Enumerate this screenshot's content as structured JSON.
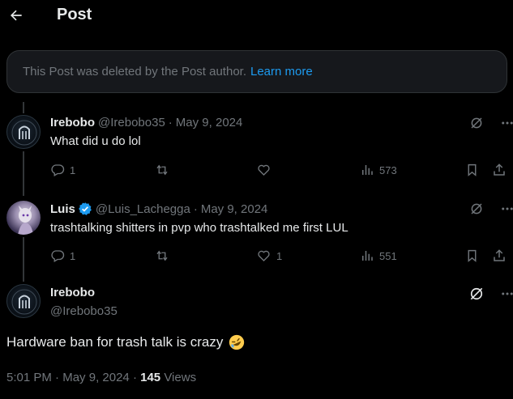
{
  "header": {
    "title": "Post",
    "back_icon": "arrow-left-icon"
  },
  "deleted_notice": {
    "text": "This Post was deleted by the Post author.",
    "link": "Learn more"
  },
  "replies": [
    {
      "name": "Irebobo",
      "handle": "@Irebobo35",
      "date": "May 9, 2024",
      "text": "What did u do lol",
      "replies": "1",
      "reposts": "",
      "likes": "",
      "views": "573"
    },
    {
      "name": "Luis",
      "verified": true,
      "handle": "@Luis_Lachegga",
      "date": "May 9, 2024",
      "text": "trashtalking shitters in pvp who trashtalked me first LUL",
      "replies": "1",
      "reposts": "",
      "likes": "1",
      "views": "551"
    }
  ],
  "main_post": {
    "name": "Irebobo",
    "handle": "@Irebobo35",
    "text": "Hardware ban for trash talk is crazy",
    "emoji": "rolling-on-floor-laughing-emoji",
    "time": "5:01 PM",
    "date": "May 9, 2024",
    "views_count": "145",
    "views_label": "Views"
  },
  "separator": "·",
  "colors": {
    "accent": "#1d9bf0",
    "muted": "#71767b",
    "text": "#e7e9ea",
    "background": "#000000"
  }
}
